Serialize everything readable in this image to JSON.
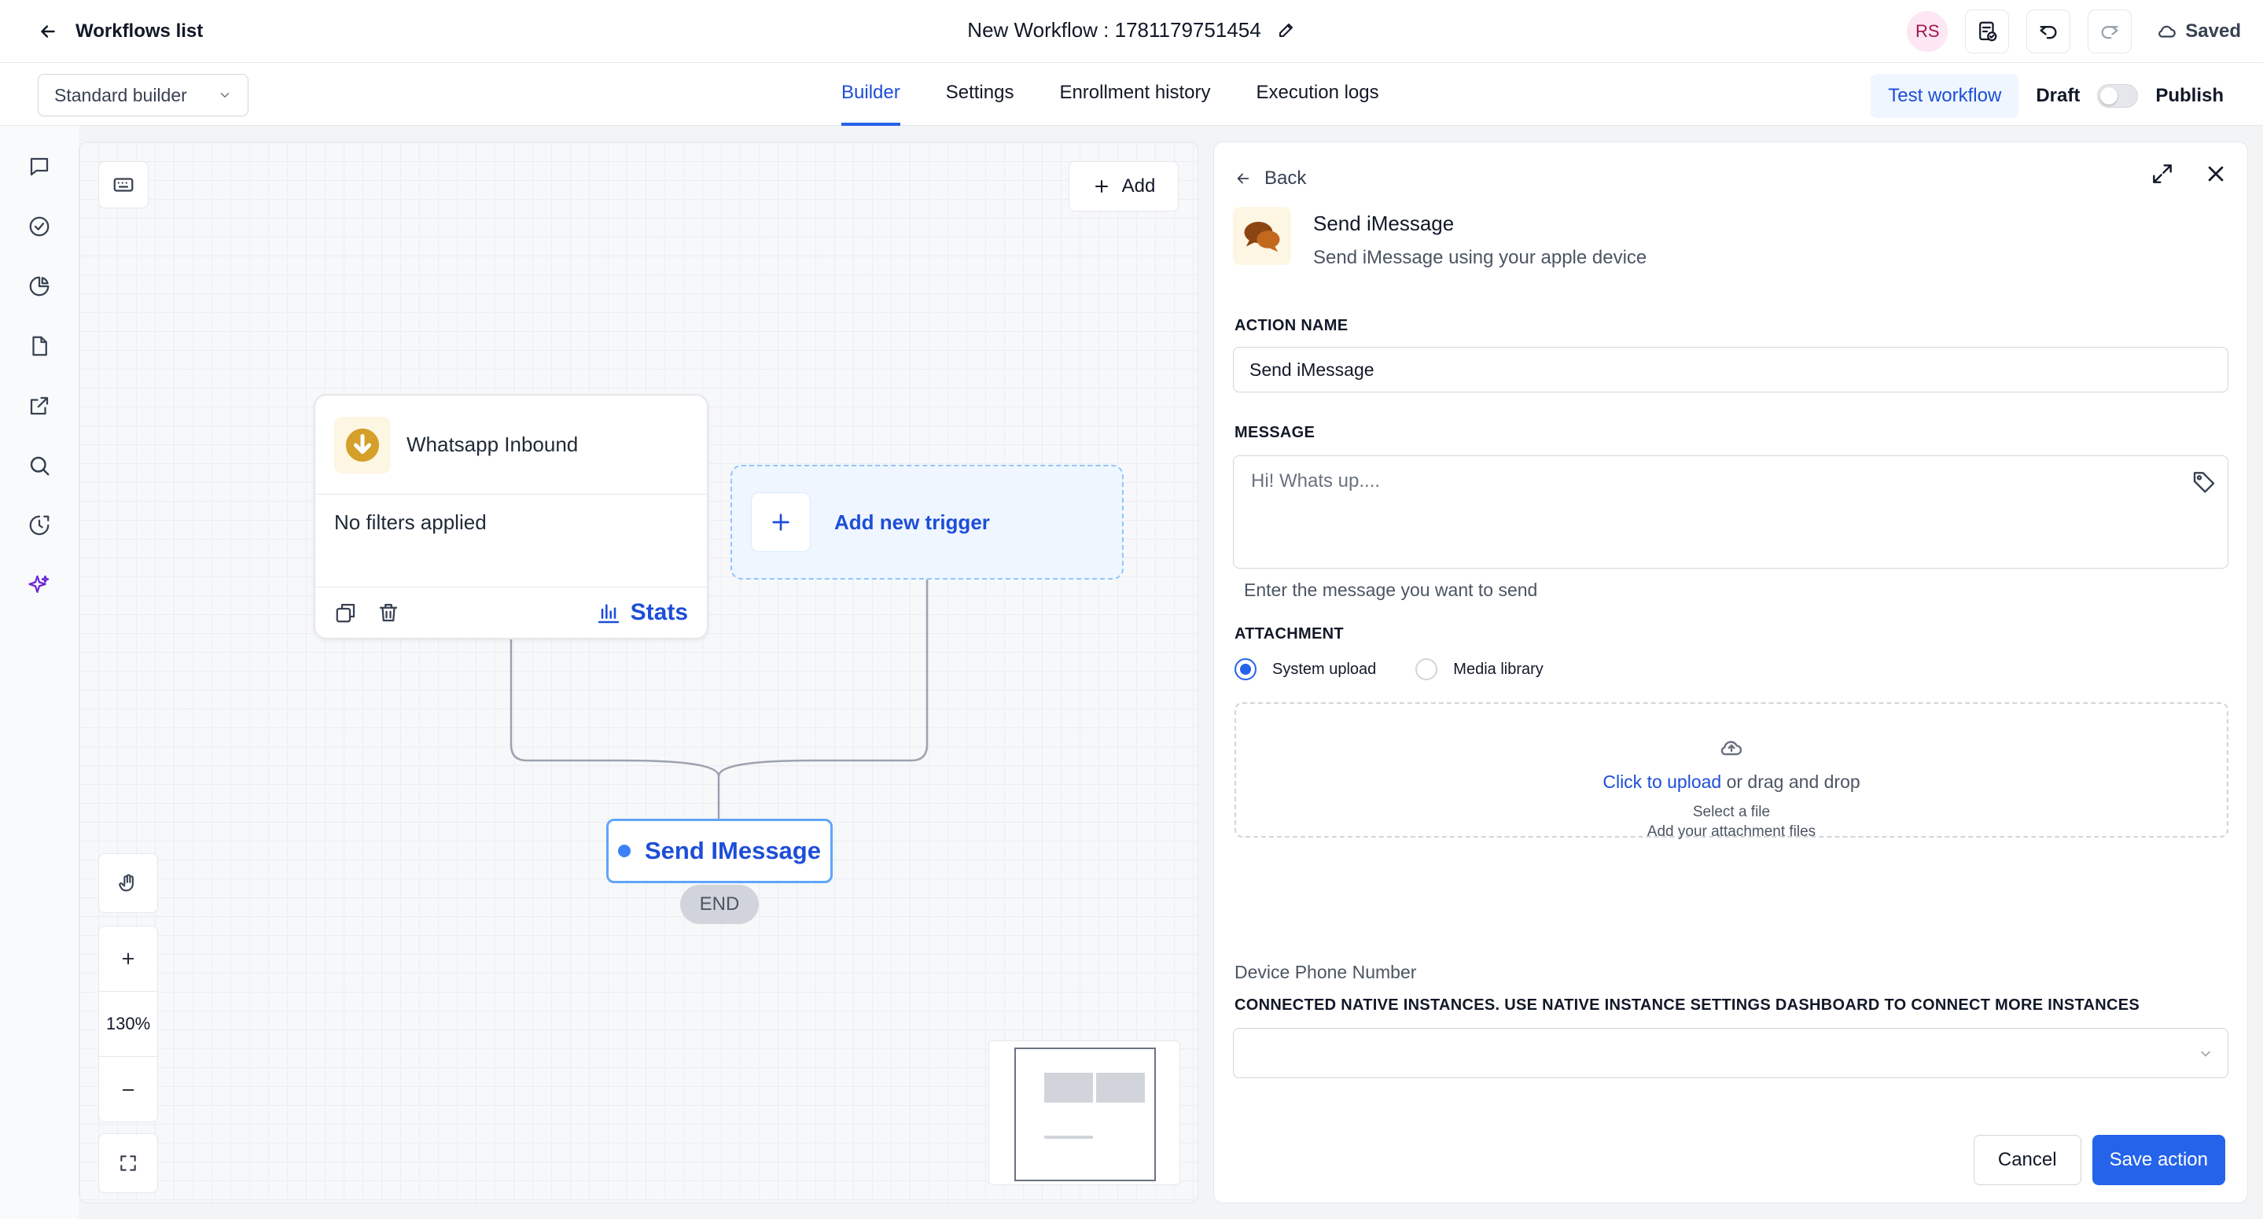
{
  "header": {
    "back_label": "Workflows list",
    "workflow_title": "New Workflow : 1781179751454",
    "avatar_initials": "RS",
    "saved_label": "Saved"
  },
  "toolbar": {
    "builder_mode": "Standard builder",
    "tabs": [
      {
        "label": "Builder",
        "active": true
      },
      {
        "label": "Settings",
        "active": false
      },
      {
        "label": "Enrollment history",
        "active": false
      },
      {
        "label": "Execution logs",
        "active": false
      }
    ],
    "test_label": "Test workflow",
    "draft_label": "Draft",
    "publish_label": "Publish",
    "published": false
  },
  "sidebar": {
    "icons": [
      "chat-icon",
      "check-circle-icon",
      "pie-chart-icon",
      "document-icon",
      "external-link-icon",
      "search-icon",
      "history-icon",
      "sparkles-icon"
    ]
  },
  "canvas": {
    "add_label": "Add",
    "zoom_level": "130%",
    "trigger": {
      "name": "Whatsapp Inbound",
      "filters_text": "No filters applied",
      "stats_label": "Stats"
    },
    "new_trigger_label": "Add new trigger",
    "action_node_label": "Send IMessage",
    "end_label": "END"
  },
  "panel": {
    "back_label": "Back",
    "title": "Send iMessage",
    "subtitle": "Send iMessage using your apple device",
    "action_name_label": "ACTION NAME",
    "action_name_value": "Send iMessage",
    "message_label": "MESSAGE",
    "message_placeholder": "Hi! Whats up....",
    "message_hint": "Enter the message you want to send",
    "attachment_label": "ATTACHMENT",
    "attachment_options": [
      {
        "label": "System upload",
        "selected": true
      },
      {
        "label": "Media library",
        "selected": false
      }
    ],
    "upload_link": "Click to upload",
    "upload_rest": " or drag and drop",
    "upload_select": "Select a file",
    "upload_hint": "Add your attachment files",
    "device_label": "Device Phone Number",
    "instances_label": "CONNECTED NATIVE INSTANCES. USE NATIVE INSTANCE SETTINGS DASHBOARD TO CONNECT MORE INSTANCES",
    "instances_value": "",
    "cancel_label": "Cancel",
    "save_label": "Save action"
  },
  "colors": {
    "accent": "#2563eb",
    "accent_text": "#1d4ed8",
    "trigger_icon": "#d4a02a",
    "sparkle": "#6d28d9"
  }
}
